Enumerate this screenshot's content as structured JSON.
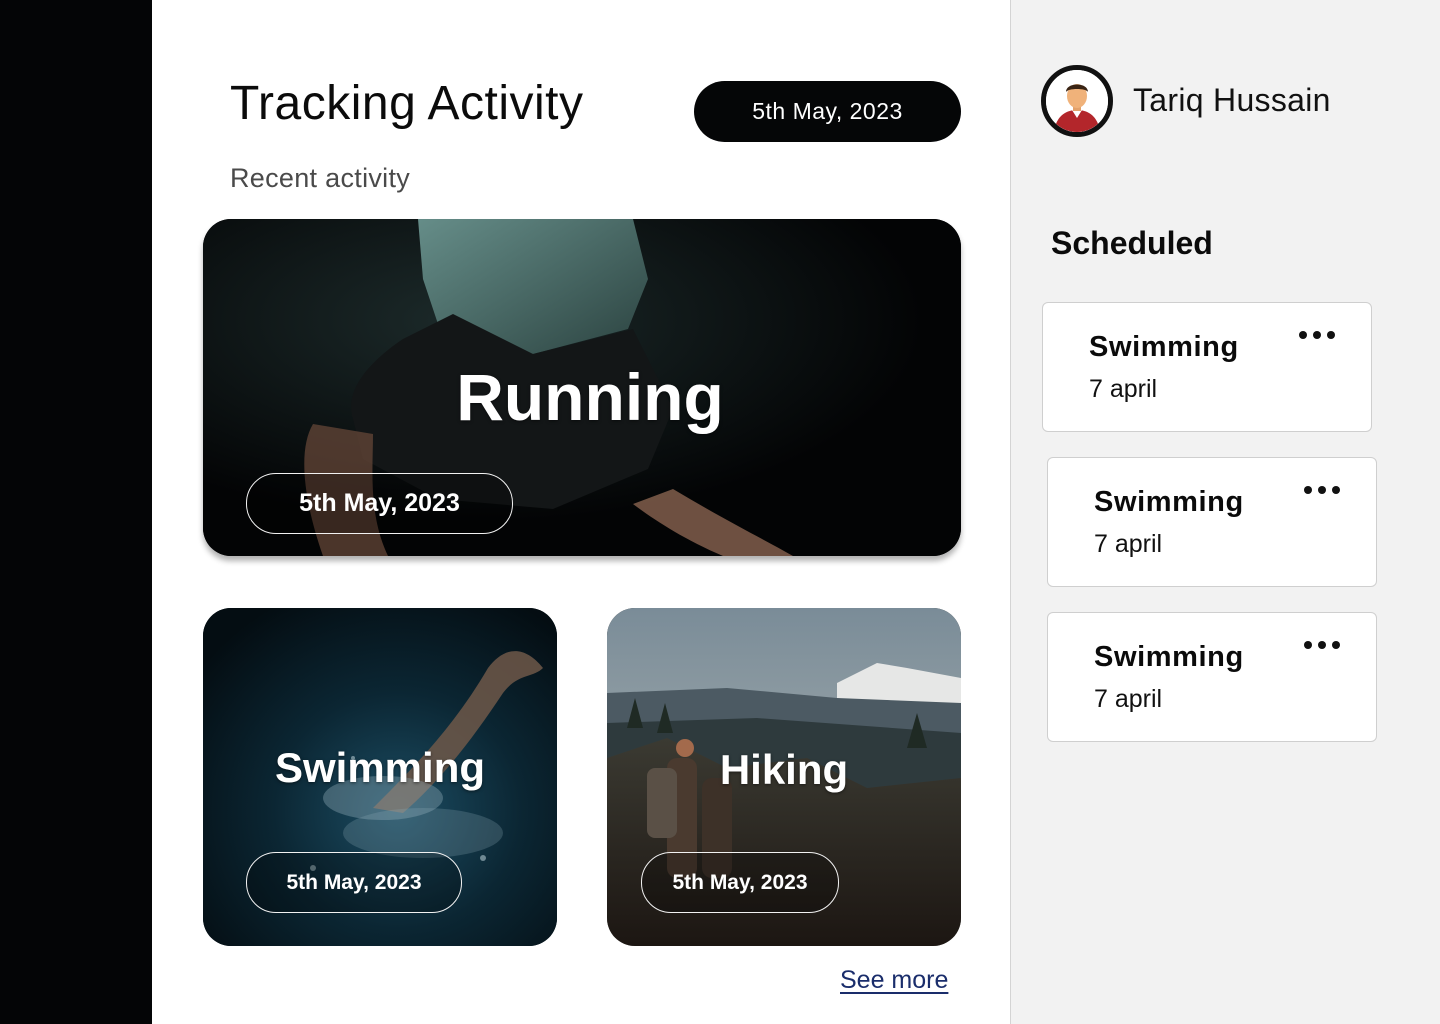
{
  "main": {
    "title": "Tracking Activity",
    "date": "5th May, 2023",
    "subtitle": "Recent activity",
    "see_more": "See more"
  },
  "activities": [
    {
      "title": "Running",
      "date": "5th May, 2023",
      "image": "runner-photo"
    },
    {
      "title": "Swimming",
      "date": "5th May, 2023",
      "image": "swimmer-photo"
    },
    {
      "title": "Hiking",
      "date": "5th May, 2023",
      "image": "hiker-photo"
    }
  ],
  "sidebar": {
    "user_name": "Tariq Hussain",
    "heading": "Scheduled",
    "items": [
      {
        "title": "Swimming",
        "date": "7 april"
      },
      {
        "title": "Swimming",
        "date": "7 april"
      },
      {
        "title": "Swimming",
        "date": "7 april"
      }
    ]
  },
  "colors": {
    "rail": "#040506",
    "sidebar_bg": "#f2f2f2",
    "link": "#1a2d6b"
  }
}
